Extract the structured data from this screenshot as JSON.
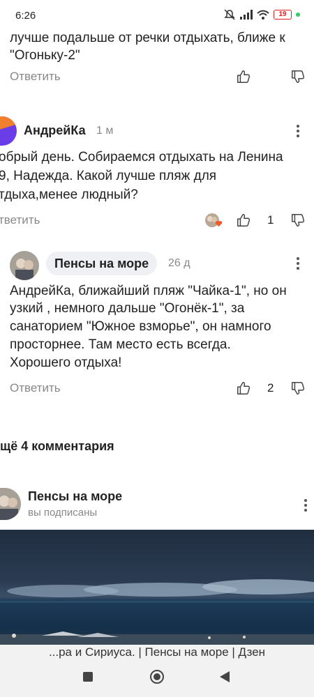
{
  "status": {
    "time": "6:26",
    "battery": "19"
  },
  "comment0": {
    "lines": [
      "лучше подальше от речки отдыхать, ближе к",
      "\"Огоньку-2\""
    ],
    "reply": "Ответить"
  },
  "comment1": {
    "author": "АндрейКа",
    "time": "1 м",
    "lines": [
      "обрый день. Собираемся отдыхать на Ленина",
      "9, Надежда. Какой лучше пляж для",
      "тдыха,менее людный?"
    ],
    "reply": "тветить",
    "likes": "1"
  },
  "comment2": {
    "author": "Пенсы на море",
    "time": "26 д",
    "lines": [
      "АндрейКа, ближайший пляж \"Чайка-1\", но он",
      "узкий , немного дальше \"Огонёк-1\", за",
      "санаторием \"Южное взморье\", он намного",
      "просторнее. Там место есть всегда.",
      "Хорошего отдыха!"
    ],
    "reply": "Ответить",
    "likes": "2"
  },
  "more_comments": "щё 4 комментария",
  "channel": {
    "name": "Пенсы на море",
    "subscribed": "вы подписаны"
  },
  "footer": {
    "url_text": "...ра и Сириуса. | Пенсы на море | Дзен"
  },
  "icons": [
    "mute-icon",
    "signal-icon",
    "wifi-icon",
    "battery-icon",
    "like-icon",
    "dislike-icon",
    "more-icon",
    "nav-recent-icon",
    "nav-home-icon",
    "nav-back-icon"
  ]
}
